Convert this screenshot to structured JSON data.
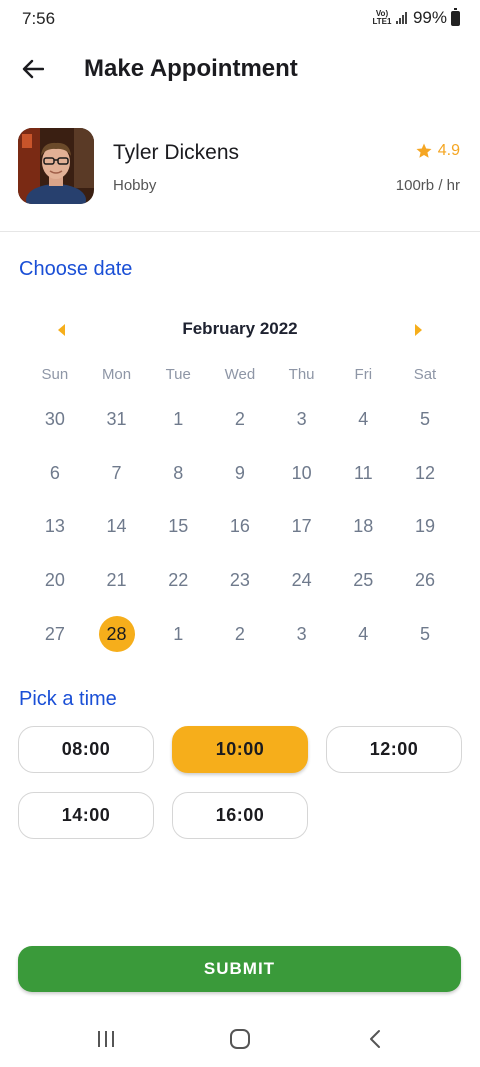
{
  "status_bar": {
    "time": "7:56",
    "network": "Vo) LTE1",
    "battery": "99%"
  },
  "app_bar": {
    "title": "Make Appointment"
  },
  "profile": {
    "name": "Tyler Dickens",
    "category": "Hobby",
    "rating": "4.9",
    "rate": "100rb / hr"
  },
  "date_section": {
    "label": "Choose date"
  },
  "calendar": {
    "month": "February 2022",
    "weekdays": [
      "Sun",
      "Mon",
      "Tue",
      "Wed",
      "Thu",
      "Fri",
      "Sat"
    ],
    "days": [
      "30",
      "31",
      "1",
      "2",
      "3",
      "4",
      "5",
      "6",
      "7",
      "8",
      "9",
      "10",
      "11",
      "12",
      "13",
      "14",
      "15",
      "16",
      "17",
      "18",
      "19",
      "20",
      "21",
      "22",
      "23",
      "24",
      "25",
      "26",
      "27",
      "28",
      "1",
      "2",
      "3",
      "4",
      "5"
    ],
    "selected": "28"
  },
  "time_section": {
    "label": "Pick a time",
    "slots": [
      "08:00",
      "10:00",
      "12:00",
      "14:00",
      "16:00"
    ],
    "selected": "10:00"
  },
  "submit": {
    "label": "SUBMIT"
  },
  "colors": {
    "accent": "#f6ae1b",
    "link": "#1a4fd6",
    "submit": "#3a9a3a"
  }
}
